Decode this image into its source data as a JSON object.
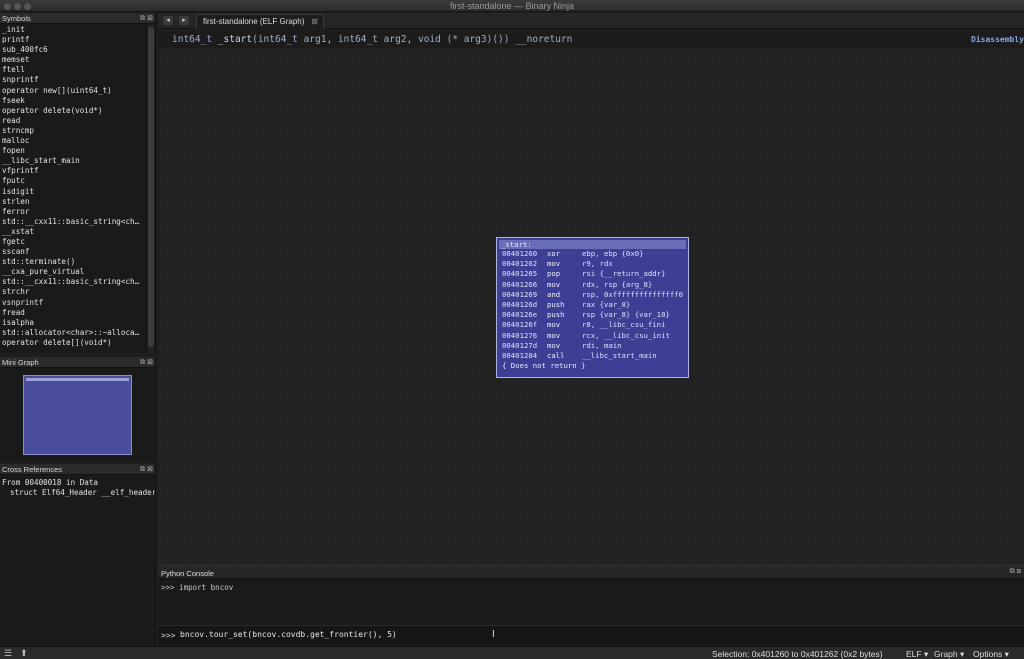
{
  "window": {
    "title": "first-standalone — Binary Ninja"
  },
  "symbols": {
    "title": "Symbols",
    "items": [
      "_init",
      "printf",
      "sub_400fc6",
      "memset",
      "ftell",
      "snprintf",
      "operator new[](uint64_t)",
      "fseek",
      "operator delete(void*)",
      "read",
      "strncmp",
      "malloc",
      "fopen",
      "__libc_start_main",
      "vfprintf",
      "fputc",
      "isdigit",
      "strlen",
      "ferror",
      "std::__cxx11::basic_string<ch…",
      "__xstat",
      "fgetc",
      "sscanf",
      "std::terminate()",
      "__cxa_pure_virtual",
      "std::__cxx11::basic_string<ch…",
      "strchr",
      "vsnprintf",
      "fread",
      "isalpha",
      "std::allocator<char>::~alloca…",
      "operator delete[](void*)"
    ]
  },
  "minigraph": {
    "title": "Mini Graph"
  },
  "xrefs": {
    "title": "Cross References",
    "line1": "From 00400018 in Data",
    "line2": "struct Elf64_Header __elf_header"
  },
  "tabs": {
    "back": "◂",
    "forward": "▸",
    "active": "first-standalone (ELF Graph)",
    "close": "⊠"
  },
  "header": {
    "ret_type": "int64_t",
    "func_name": "_start",
    "params": "(int64_t arg1, int64_t arg2, void (* arg3)()) __noreturn",
    "view_label": "Disassembly"
  },
  "block": {
    "label": "_start:",
    "rows": [
      {
        "addr": "00401260",
        "mnem": "xor",
        "ops": "ebp, ebp  {0x0}"
      },
      {
        "addr": "00401262",
        "mnem": "mov",
        "ops": "r9, rdx"
      },
      {
        "addr": "00401265",
        "mnem": "pop",
        "ops": "rsi {__return_addr}"
      },
      {
        "addr": "00401266",
        "mnem": "mov",
        "ops": "rdx, rsp {arg_8}"
      },
      {
        "addr": "00401269",
        "mnem": "and",
        "ops": "rsp, 0xfffffffffffffff0"
      },
      {
        "addr": "0040126d",
        "mnem": "push",
        "ops": "rax {var_8}"
      },
      {
        "addr": "0040126e",
        "mnem": "push",
        "ops": "rsp {var_8} {var_10}"
      },
      {
        "addr": "0040126f",
        "mnem": "mov",
        "ops": "r8, __libc_csu_fini"
      },
      {
        "addr": "00401276",
        "mnem": "mov",
        "ops": "rcx, __libc_csu_init"
      },
      {
        "addr": "0040127d",
        "mnem": "mov",
        "ops": "rdi, main"
      },
      {
        "addr": "00401284",
        "mnem": "call",
        "ops": "__libc_start_main"
      }
    ],
    "footer": "{ Does not return }"
  },
  "console": {
    "title": "Python Console",
    "output_line": ">>> import bncov",
    "prompt": ">>>",
    "input_value": "bncov.tour_set(bncov.covdb.get_frontier(), 5)"
  },
  "status": {
    "selection": "Selection: 0x401260 to 0x401262 (0x2 bytes)",
    "format": "ELF ▾",
    "view": "Graph ▾",
    "options": "Options ▾"
  }
}
